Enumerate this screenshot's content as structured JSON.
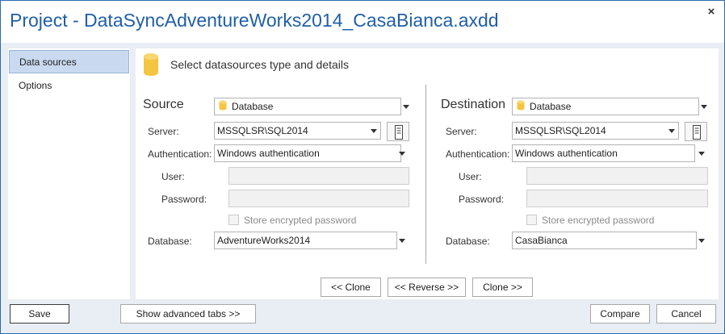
{
  "window": {
    "title": "Project - DataSyncAdventureWorks2014_CasaBianca.axdd",
    "close_glyph": "×"
  },
  "sidebar": {
    "items": [
      {
        "label": "Data sources",
        "active": true
      },
      {
        "label": "Options",
        "active": false
      }
    ]
  },
  "content": {
    "header": "Select datasources type and details"
  },
  "source": {
    "title": "Source",
    "type_value": "Database",
    "server_label": "Server:",
    "server_value": "MSSQLSR\\SQL2014",
    "auth_label": "Authentication:",
    "auth_value": "Windows authentication",
    "user_label": "User:",
    "user_value": "",
    "password_label": "Password:",
    "password_value": "",
    "store_label": "Store encrypted password",
    "database_label": "Database:",
    "database_value": "AdventureWorks2014"
  },
  "destination": {
    "title": "Destination",
    "type_value": "Database",
    "server_label": "Server:",
    "server_value": "MSSQLSR\\SQL2014",
    "auth_label": "Authentication:",
    "auth_value": "Windows authentication",
    "user_label": "User:",
    "user_value": "",
    "password_label": "Password:",
    "password_value": "",
    "store_label": "Store encrypted password",
    "database_label": "Database:",
    "database_value": "CasaBianca"
  },
  "actions": {
    "clone_left": "<< Clone",
    "reverse": "<< Reverse >>",
    "clone_right": "Clone >>"
  },
  "footer": {
    "save": "Save",
    "advanced": "Show advanced tabs >>",
    "compare": "Compare",
    "cancel": "Cancel"
  },
  "icons": {
    "database": "database-icon",
    "server_browse": "server-icon",
    "close": "close-icon",
    "dropdown": "chevron-down-icon"
  },
  "colors": {
    "title": "#1f5fa8",
    "panel_bg": "#e9eef4",
    "active_item": "#c9d9f0",
    "database_icon": "#f5c542"
  }
}
